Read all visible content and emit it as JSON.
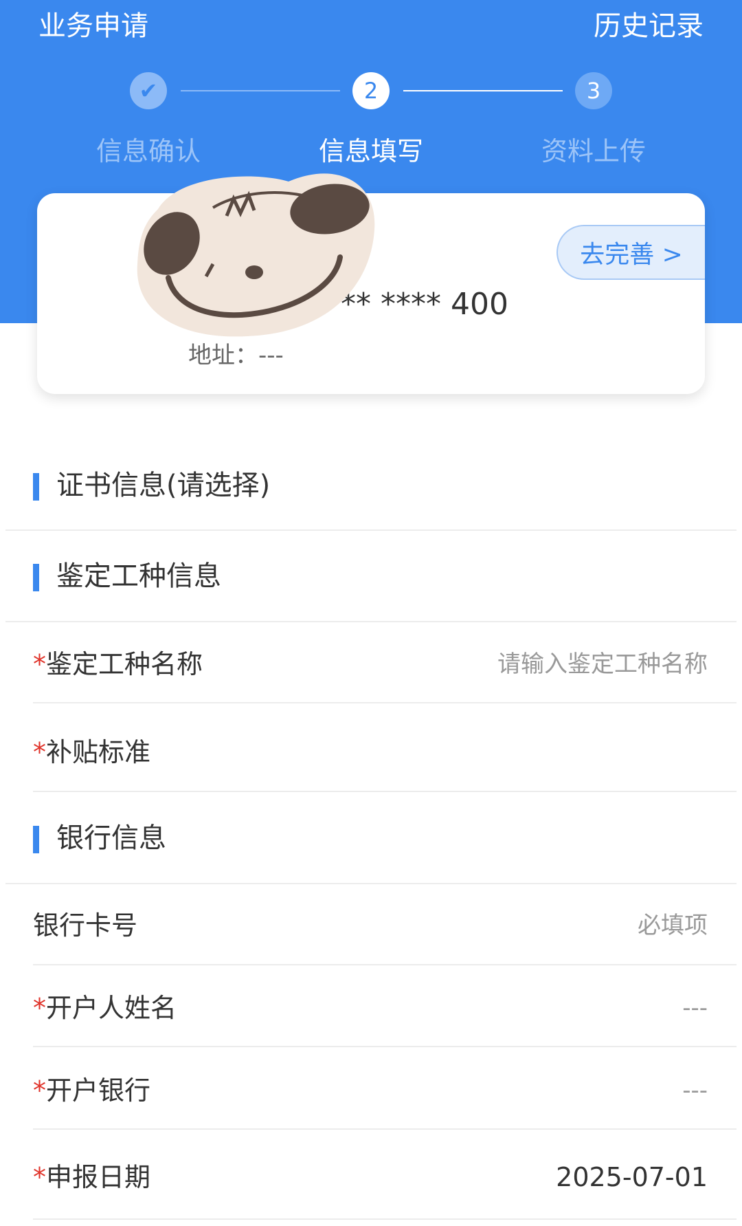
{
  "header": {
    "title": "业务申请",
    "history_link": "历史记录",
    "accent_color": "#3a88ee"
  },
  "stepper": {
    "steps": [
      {
        "number": "✔",
        "label": "信息确认",
        "state": "done"
      },
      {
        "number": "2",
        "label": "信息填写",
        "state": "active"
      },
      {
        "number": "3",
        "label": "资料上传",
        "state": "pending"
      }
    ]
  },
  "profile_card": {
    "phone_masked": "** **** 400",
    "address_label": "地址：",
    "address_value": "---",
    "complete_button": "去完善 >"
  },
  "sections": {
    "certificate": {
      "title": "证书信息(请选择)"
    },
    "skill": {
      "title": "鉴定工种信息",
      "skill_name": {
        "required_mark": "*",
        "label": "鉴定工种名称",
        "placeholder": "请输入鉴定工种名称"
      },
      "subsidy": {
        "required_mark": "*",
        "label": "补贴标准",
        "value": ""
      }
    },
    "bank": {
      "title": "银行信息",
      "card_number": {
        "label": "银行卡号",
        "placeholder": "必填项"
      },
      "account_name": {
        "required_mark": "*",
        "label": "开户人姓名",
        "value": "---"
      },
      "bank_name": {
        "required_mark": "*",
        "label": "开户银行",
        "value": "---"
      },
      "report_date": {
        "required_mark": "*",
        "label": "申报日期",
        "value": "2025-07-01"
      }
    }
  }
}
